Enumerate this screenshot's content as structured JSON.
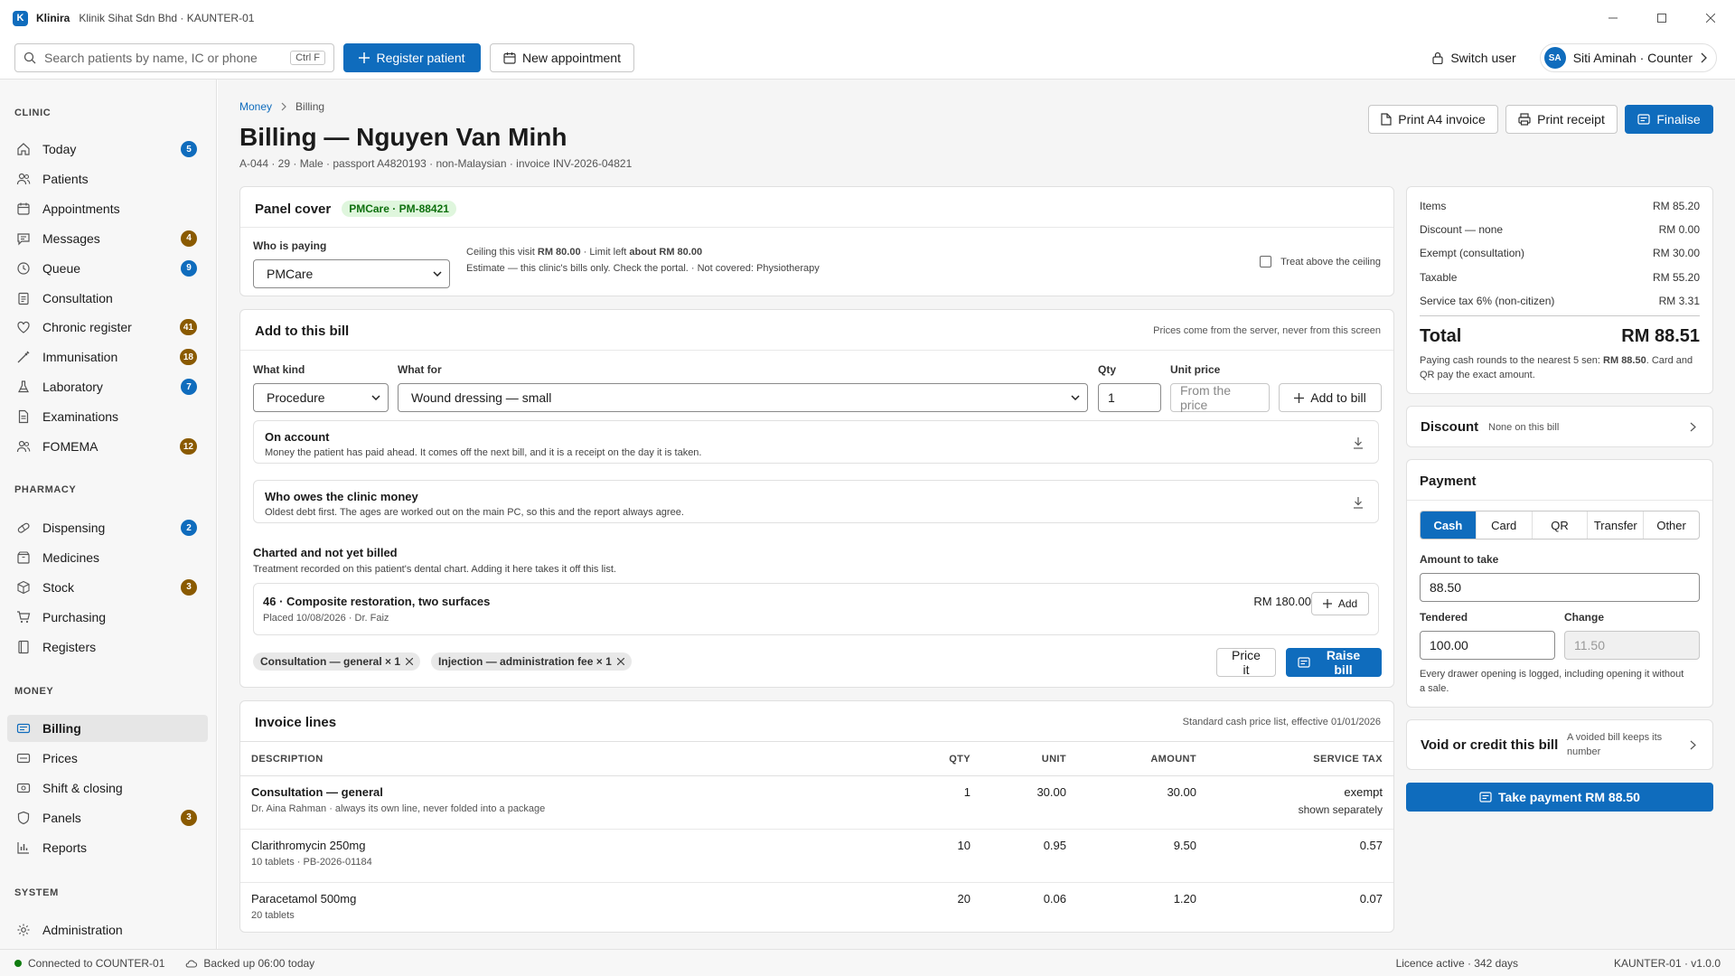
{
  "window": {
    "app_name": "Klinira",
    "subtitle": "Klinik Sihat Sdn Bhd · KAUNTER-01",
    "logo_letter": "K"
  },
  "toolbar": {
    "search_placeholder": "Search patients by name, IC or phone",
    "search_shortcut": "Ctrl F",
    "register_label": "Register patient",
    "appointment_label": "New appointment",
    "switch_user_label": "Switch user",
    "user_initials": "SA",
    "user_label": "Siti Aminah · Counter"
  },
  "sidebar": {
    "clinic_heading": "CLINIC",
    "clinic": [
      {
        "label": "Today",
        "badge": "5",
        "badge_color": "#0f6cbd",
        "icon": "home-icon"
      },
      {
        "label": "Patients",
        "badge": "",
        "icon": "people-icon"
      },
      {
        "label": "Appointments",
        "badge": "",
        "icon": "calendar-icon"
      },
      {
        "label": "Messages",
        "badge": "4",
        "badge_color": "#8a5a00",
        "icon": "chat-icon"
      },
      {
        "label": "Queue",
        "badge": "9",
        "badge_color": "#0f6cbd",
        "icon": "clock-icon"
      },
      {
        "label": "Consultation",
        "badge": "",
        "icon": "clipboard-icon"
      },
      {
        "label": "Chronic register",
        "badge": "41",
        "badge_color": "#8a5a00",
        "icon": "heart-icon"
      },
      {
        "label": "Immunisation",
        "badge": "18",
        "badge_color": "#8a5a00",
        "icon": "syringe-icon"
      },
      {
        "label": "Laboratory",
        "badge": "7",
        "badge_color": "#0f6cbd",
        "icon": "flask-icon"
      },
      {
        "label": "Examinations",
        "badge": "",
        "icon": "document-icon"
      },
      {
        "label": "FOMEMA",
        "badge": "12",
        "badge_color": "#8a5a00",
        "icon": "people-icon"
      }
    ],
    "pharmacy_heading": "PHARMACY",
    "pharmacy": [
      {
        "label": "Dispensing",
        "badge": "2",
        "badge_color": "#0f6cbd",
        "icon": "pill-icon"
      },
      {
        "label": "Medicines",
        "badge": "",
        "icon": "box-icon"
      },
      {
        "label": "Stock",
        "badge": "3",
        "badge_color": "#8a5a00",
        "icon": "cube-icon"
      },
      {
        "label": "Purchasing",
        "badge": "",
        "icon": "cart-icon"
      },
      {
        "label": "Registers",
        "badge": "",
        "icon": "book-icon"
      }
    ],
    "money_heading": "MONEY",
    "money": [
      {
        "label": "Billing",
        "badge": "",
        "icon": "receipt-icon"
      },
      {
        "label": "Prices",
        "badge": "",
        "icon": "tag-icon"
      },
      {
        "label": "Shift & closing",
        "badge": "",
        "icon": "money-icon"
      },
      {
        "label": "Panels",
        "badge": "3",
        "badge_color": "#8a5a00",
        "icon": "shield-icon"
      },
      {
        "label": "Reports",
        "badge": "",
        "icon": "chart-icon"
      }
    ],
    "system_heading": "SYSTEM",
    "system": [
      {
        "label": "Administration",
        "badge": "",
        "icon": "gear-icon"
      }
    ]
  },
  "page": {
    "breadcrumb_root": "Money",
    "breadcrumb_current": "Billing",
    "title": "Billing — Nguyen Van Minh",
    "subtitle": "A-044 · 29 · Male · passport A4820193 · non-Malaysian · invoice INV-2026-04821",
    "print_a4_label": "Print A4 invoice",
    "print_receipt_label": "Print receipt",
    "finalise_label": "Finalise"
  },
  "panel_cover": {
    "title": "Panel cover",
    "badge": "PMCare · PM-88421",
    "who_label": "Who is paying",
    "who_value": "PMCare",
    "ceiling_prefix": "Ceiling this visit",
    "ceiling_value": "RM 80.00",
    "limit_prefix": "· Limit left",
    "limit_value": "about RM 80.00",
    "estimate_note": "Estimate — this clinic's bills only. Check the portal. · Not covered: Physiotherapy",
    "treat_label": "Treat above the ceiling"
  },
  "add_bill": {
    "title": "Add to this bill",
    "note": "Prices come from the server, never from this screen",
    "kind_label": "What kind",
    "kind_value": "Procedure",
    "for_label": "What for",
    "for_value": "Wound dressing — small",
    "qty_label": "Qty",
    "qty_value": "1",
    "unit_label": "Unit price",
    "unit_placeholder": "From the price",
    "add_label": "Add to bill",
    "on_account_title": "On account",
    "on_account_desc": "Money the patient has paid ahead. It comes off the next bill, and it is a receipt on the day it is taken.",
    "owes_title": "Who owes the clinic money",
    "owes_desc": "Oldest debt first. The ages are worked out on the main PC, so this and the report always agree.",
    "charted_title": "Charted and not yet billed",
    "charted_desc": "Treatment recorded on this patient's dental chart. Adding it here takes it off this list.",
    "charted_item": "46 · Composite restoration, two surfaces",
    "charted_meta": "Placed 10/08/2026 · Dr. Faiz",
    "charted_price": "RM 180.00",
    "charted_add": "Add",
    "chips": [
      "Consultation — general × 1",
      "Injection — administration fee × 1"
    ],
    "price_it": "Price it",
    "raise_bill": "Raise bill"
  },
  "invoice": {
    "title": "Invoice lines",
    "note": "Standard cash price list, effective 01/01/2026",
    "headers": {
      "desc": "DESCRIPTION",
      "qty": "QTY",
      "unit": "UNIT",
      "amount": "AMOUNT",
      "tax": "SERVICE TAX"
    },
    "rows": [
      {
        "desc": "Consultation — general",
        "sub": "Dr. Aina Rahman · always its own line, never folded into a package",
        "qty": "1",
        "unit": "30.00",
        "amount": "30.00",
        "tax": "exempt",
        "tax_sub": "shown separately"
      },
      {
        "desc": "Clarithromycin 250mg",
        "sub": "10 tablets · PB-2026-01184",
        "qty": "10",
        "unit": "0.95",
        "amount": "9.50",
        "tax": "0.57",
        "tax_sub": ""
      },
      {
        "desc": "Paracetamol 500mg",
        "sub": "20 tablets",
        "qty": "20",
        "unit": "0.06",
        "amount": "1.20",
        "tax": "0.07",
        "tax_sub": ""
      }
    ]
  },
  "summary": {
    "rows": [
      {
        "label": "Items",
        "value": "RM 85.20"
      },
      {
        "label": "Discount — none",
        "value": "RM 0.00"
      },
      {
        "label": "Exempt (consultation)",
        "value": "RM 30.00"
      },
      {
        "label": "Taxable",
        "value": "RM 55.20"
      },
      {
        "label": "Service tax 6% (non-citizen)",
        "value": "RM 3.31"
      }
    ],
    "total_label": "Total",
    "total_value": "RM 88.51",
    "rounding_prefix": "Paying cash rounds to the nearest 5 sen:",
    "rounding_value": "RM 88.50",
    "rounding_suffix": ". Card and QR pay the exact amount."
  },
  "discount": {
    "title": "Discount",
    "value": "None on this bill"
  },
  "payment": {
    "title": "Payment",
    "methods": [
      "Cash",
      "Card",
      "QR",
      "Transfer",
      "Other"
    ],
    "amount_label": "Amount to take",
    "amount_value": "88.50",
    "tendered_label": "Tendered",
    "tendered_value": "100.00",
    "change_label": "Change",
    "change_value": "11.50",
    "note": "Every drawer opening is logged, including opening it without a sale."
  },
  "void": {
    "title": "Void or credit this bill",
    "desc": "A voided bill keeps its number"
  },
  "take_payment_label": "Take payment RM 88.50",
  "status": {
    "connected": "Connected to COUNTER-01",
    "backup": "Backed up 06:00 today",
    "licence": "Licence active · 342 days",
    "version": "KAUNTER-01 · v1.0.0"
  },
  "colors": {
    "accent": "#0f6cbd",
    "badge_amber": "#8a5a00",
    "badge_green_bg": "#dff6dd",
    "badge_green_fg": "#0e700e"
  }
}
